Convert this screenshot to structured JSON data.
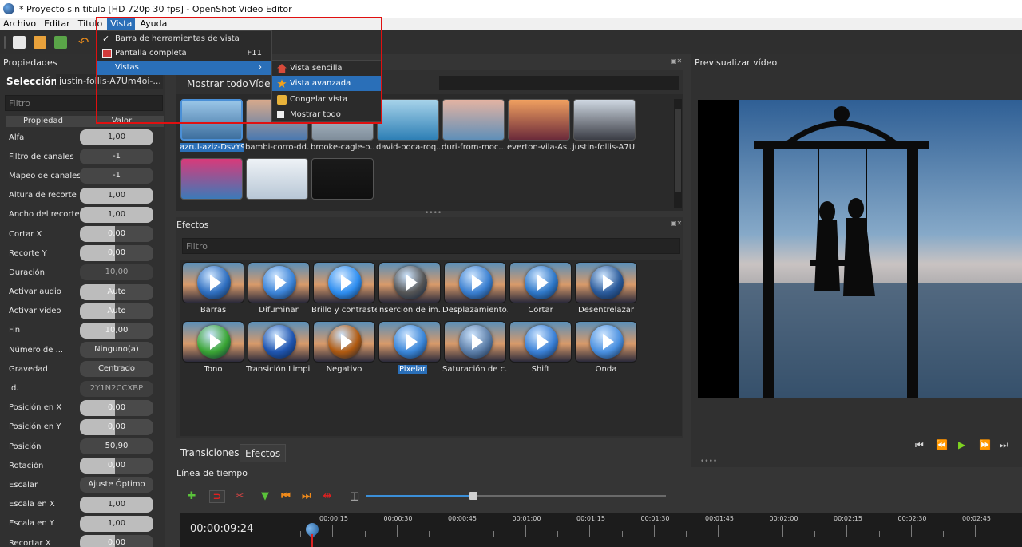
{
  "window": {
    "title": "* Proyecto sin titulo [HD 720p 30 fps] - OpenShot Video Editor"
  },
  "menubar": {
    "items": [
      {
        "label": "Archivo"
      },
      {
        "label": "Editar"
      },
      {
        "label": "Titulo"
      },
      {
        "label": "Vista"
      },
      {
        "label": "Ayuda"
      }
    ]
  },
  "vista_menu": {
    "items": [
      {
        "label": "Barra de herramientas de vista",
        "checked": true,
        "shortcut": ""
      },
      {
        "label": "Pantalla completa",
        "shortcut": "F11"
      },
      {
        "label": "Vistas",
        "shortcut": ""
      }
    ],
    "submenu": [
      {
        "label": "Vista sencilla",
        "icon": "house-icon"
      },
      {
        "label": "Vista avanzada",
        "icon": "star-icon"
      },
      {
        "label": "Congelar vista",
        "icon": "lock-icon"
      },
      {
        "label": "Mostrar todo",
        "icon": "square-icon"
      }
    ]
  },
  "properties": {
    "title": "Propiedades",
    "selection_label": "Selección:",
    "selection_value": "justin-follis-A7Um4oi-...",
    "filter_placeholder": "Filtro",
    "col_property": "Propiedad",
    "col_value": "Valor",
    "rows": [
      {
        "name": "Alfa",
        "value": "1,00",
        "style": "full"
      },
      {
        "name": "Filtro de canales",
        "value": "-1",
        "style": "plain"
      },
      {
        "name": "Mapeo de canales",
        "value": "-1",
        "style": "plain"
      },
      {
        "name": "Altura de recorte",
        "value": "1,00",
        "style": "full"
      },
      {
        "name": "Ancho del recorte",
        "value": "1,00",
        "style": "full"
      },
      {
        "name": "Cortar X",
        "value": "0,00",
        "style": "fill"
      },
      {
        "name": "Recorte Y",
        "value": "0,00",
        "style": "fill"
      },
      {
        "name": "Duración",
        "value": "10,00",
        "style": "dim"
      },
      {
        "name": "Activar audio",
        "value": "Auto",
        "style": "fill"
      },
      {
        "name": "Activar vídeo",
        "value": "Auto",
        "style": "fill"
      },
      {
        "name": "Fin",
        "value": "10,00",
        "style": "fill"
      },
      {
        "name": "Número de ...",
        "value": "Ninguno(a)",
        "style": "plain"
      },
      {
        "name": "Gravedad",
        "value": "Centrado",
        "style": "plain"
      },
      {
        "name": "Id.",
        "value": "2Y1N2CCXBP",
        "style": "dim"
      },
      {
        "name": "Posición en X",
        "value": "0,00",
        "style": "fill"
      },
      {
        "name": "Posición en Y",
        "value": "0,00",
        "style": "fill"
      },
      {
        "name": "Posición",
        "value": "50,90",
        "style": "plain"
      },
      {
        "name": "Rotación",
        "value": "0,00",
        "style": "fill"
      },
      {
        "name": "Escalar",
        "value": "Ajuste Óptimo",
        "style": "plain"
      },
      {
        "name": "Escala en X",
        "value": "1,00",
        "style": "full"
      },
      {
        "name": "Escala en Y",
        "value": "1,00",
        "style": "full"
      },
      {
        "name": "Recortar X",
        "value": "0,00",
        "style": "fill"
      }
    ]
  },
  "files": {
    "tab_show_all": "Mostrar todo",
    "tab_video": "Vídeo",
    "items": [
      {
        "label": "azrul-aziz-DsvY9...",
        "selected": true,
        "c1": "#9ac6e8",
        "c2": "#3d6f9e"
      },
      {
        "label": "bambi-corro-dd...",
        "c1": "#d7a98b",
        "c2": "#4a79b0"
      },
      {
        "label": "brooke-cagle-o...",
        "c1": "#c9d6e2",
        "c2": "#7f8d9a"
      },
      {
        "label": "david-boca-roq...",
        "c1": "#a7d3ea",
        "c2": "#2d7fb5"
      },
      {
        "label": "duri-from-moc...",
        "c1": "#e3b3a2",
        "c2": "#5f8fb8"
      },
      {
        "label": "everton-vila-As...",
        "c1": "#f0a060",
        "c2": "#6b2a3a"
      },
      {
        "label": "justin-follis-A7U...",
        "c1": "#cfd8e2",
        "c2": "#3b3d45"
      },
      {
        "label": "",
        "c1": "#d83a7a",
        "c2": "#3c7ab8"
      },
      {
        "label": "",
        "c1": "#eef2f6",
        "c2": "#b8c7d6"
      },
      {
        "label": "",
        "c1": "#1a1a1a",
        "c2": "#101010"
      }
    ]
  },
  "effects": {
    "title": "Efectos",
    "filter_placeholder": "Filtro",
    "items": [
      {
        "label": "Barras",
        "orb": "#2f6fc0"
      },
      {
        "label": "Difuminar",
        "orb": "#3c84d8"
      },
      {
        "label": "Brillo y contraste",
        "orb": "#2e8ef0"
      },
      {
        "label": "Insercion de im...",
        "orb": "#555555"
      },
      {
        "label": "Desplazamiento...",
        "orb": "#3a7fd0"
      },
      {
        "label": "Cortar",
        "orb": "#2f78c8"
      },
      {
        "label": "Desentrelazar",
        "orb": "#2a5a9a"
      },
      {
        "label": "Tono",
        "orb": "#3aa534"
      },
      {
        "label": "Transición Limpi...",
        "orb": "#1f55b0"
      },
      {
        "label": "Negativo",
        "orb": "#b05a10"
      },
      {
        "label": "Pixelar",
        "orb": "#3a86d8",
        "selected": true
      },
      {
        "label": "Saturación de c...",
        "orb": "#5c7ea8"
      },
      {
        "label": "Shift",
        "orb": "#3a80d6"
      },
      {
        "label": "Onda",
        "orb": "#4a90e0"
      }
    ]
  },
  "bottom_tabs": [
    {
      "label": "Transiciones"
    },
    {
      "label": "Efectos",
      "active": true
    }
  ],
  "timeline": {
    "title": "Línea de tiempo",
    "timecode": "00:00:09:24",
    "marks": [
      "00:00:15",
      "00:00:30",
      "00:00:45",
      "00:01:00",
      "00:01:15",
      "00:01:30",
      "00:01:45",
      "00:02:00",
      "00:02:15",
      "00:02:30",
      "00:02:45"
    ]
  },
  "preview": {
    "title": "Previsualizar vídeo",
    "controls": [
      "⏮",
      "⏪",
      "▶",
      "⏩",
      "⏭"
    ]
  },
  "colors": {
    "accent": "#2a6fb8",
    "highlight_box": "#e01010",
    "play": "#7ed321"
  }
}
